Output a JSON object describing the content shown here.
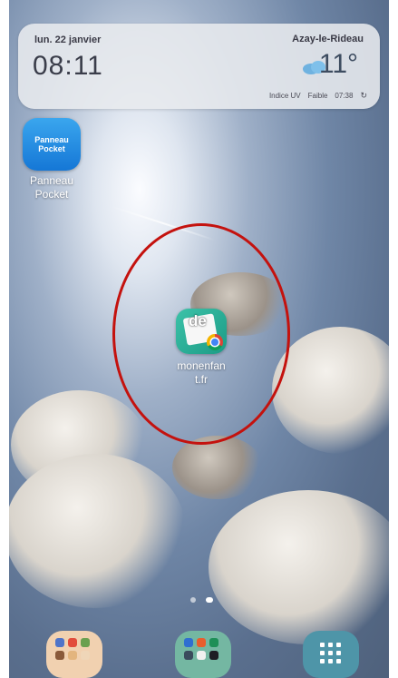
{
  "widget": {
    "date": "lun. 22 janvier",
    "time": "08:11",
    "city": "Azay-le-Rideau",
    "temperature": "11°",
    "uv_label": "Indice UV",
    "uv_value": "Faible",
    "updated": "07:38"
  },
  "apps": {
    "panneau_pocket": {
      "icon_text_top": "Panneau",
      "icon_text_bottom": "Pocket",
      "label": "Panneau\nPocket"
    },
    "monenfant": {
      "icon_text": "de",
      "label": "monenfan\nt.fr"
    }
  },
  "highlight_color": "#c4120e",
  "page_indicator": {
    "pages": 2,
    "active": 2
  },
  "dock": [
    "folder-1",
    "folder-2",
    "apps-drawer"
  ]
}
